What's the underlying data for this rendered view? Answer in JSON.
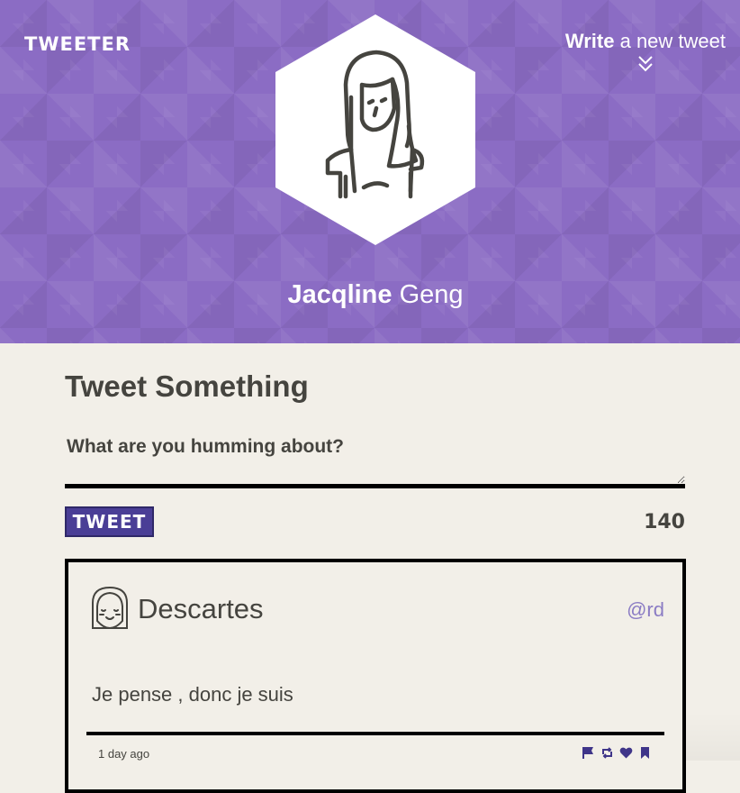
{
  "header": {
    "logo": "TWEETER",
    "write_bold": "Write",
    "write_rest": " a new tweet",
    "user_first": "Jacqline",
    "user_last": " Geng"
  },
  "composer": {
    "title": "Tweet Something",
    "placeholder": "What are you humming about?",
    "button_label": "TWEET",
    "char_count": "140"
  },
  "tweet": {
    "author": "Descartes",
    "handle": "@rd",
    "text": "Je pense , donc je suis",
    "timestamp": "1 day ago",
    "actions": [
      "flag-icon",
      "retweet-icon",
      "heart-icon",
      "bookmark-icon"
    ]
  },
  "colors": {
    "header_purple": "#8b6cc4",
    "button_purple": "#4a3e96",
    "handle_purple": "#8b7cc4",
    "background": "#f2efe8",
    "text": "#45443f"
  }
}
